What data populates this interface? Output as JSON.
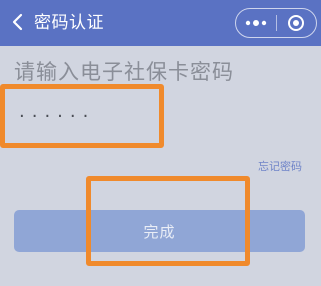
{
  "navbar": {
    "title": "密码认证",
    "back_icon": "chevron-left-icon",
    "menu_icon": "more-dots-icon",
    "close_icon": "target-circle-icon",
    "background_color": "#5a72c3"
  },
  "main": {
    "prompt": "请输入电子社保卡密码",
    "password_value": "······",
    "forgot_link": "忘记密码",
    "done_label": "完成",
    "accent_color": "#f08a2c"
  }
}
